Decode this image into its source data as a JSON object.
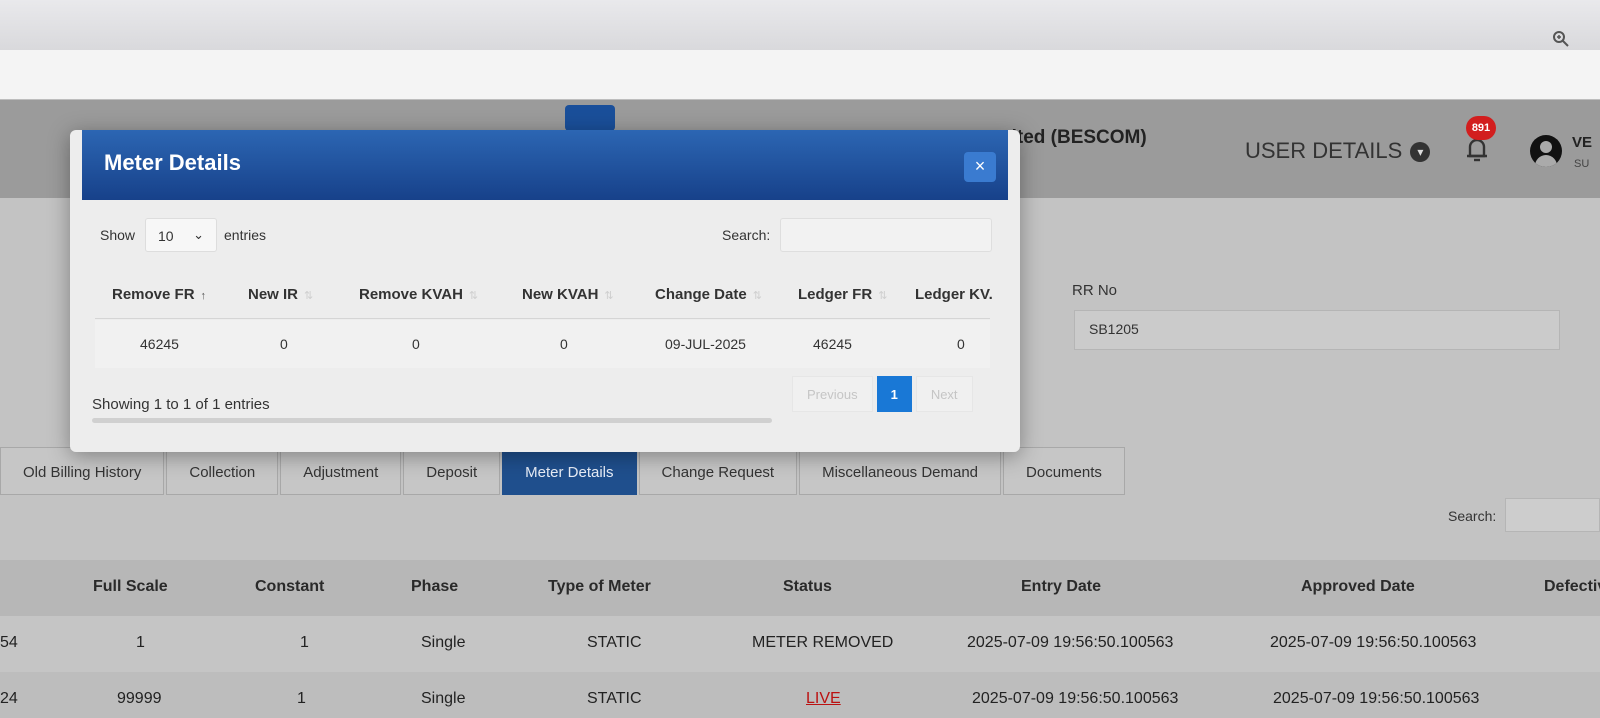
{
  "header": {
    "company": "nited (BESCOM)",
    "user_details": "USER DETAILS",
    "notification_count": "891",
    "user_name": "VE",
    "user_sub": "SU"
  },
  "form": {
    "rr_label": "RR No",
    "rr_value": "SB1205"
  },
  "tabs": [
    {
      "label": "Old Billing History"
    },
    {
      "label": "Collection"
    },
    {
      "label": "Adjustment"
    },
    {
      "label": "Deposit"
    },
    {
      "label": "Meter Details",
      "active": true
    },
    {
      "label": "Change Request"
    },
    {
      "label": "Miscellaneous Demand"
    },
    {
      "label": "Documents"
    }
  ],
  "bg_table": {
    "search_label": "Search:",
    "columns": [
      "Full Scale",
      "Constant",
      "Phase",
      "Type of Meter",
      "Status",
      "Entry Date",
      "Approved Date",
      "Defectiv"
    ],
    "rows": [
      {
        "id": "54",
        "full_scale": "1",
        "constant": "1",
        "phase": "Single",
        "type": "STATIC",
        "status": "METER REMOVED",
        "entry_date": "2025-07-09 19:56:50.100563",
        "approved_date": "2025-07-09 19:56:50.100563"
      },
      {
        "id": "24",
        "full_scale": "99999",
        "constant": "1",
        "phase": "Single",
        "type": "STATIC",
        "status": "LIVE",
        "entry_date": "2025-07-09 19:56:50.100563",
        "approved_date": "2025-07-09 19:56:50.100563"
      }
    ]
  },
  "modal": {
    "title": "Meter Details",
    "close_icon": "×",
    "show_label": "Show",
    "entries_value": "10",
    "entries_label": "entries",
    "search_label": "Search:",
    "columns": [
      "Remove FR",
      "New IR",
      "Remove KVAH",
      "New KVAH",
      "Change Date",
      "Ledger FR",
      "Ledger KV."
    ],
    "row": {
      "remove_fr": "46245",
      "new_ir": "0",
      "remove_kvah": "0",
      "new_kvah": "0",
      "change_date": "09-JUL-2025",
      "ledger_fr": "46245",
      "ledger_kv": "0"
    },
    "showing": "Showing 1 to 1 of 1 entries",
    "pager": {
      "previous": "Previous",
      "page": "1",
      "next": "Next"
    }
  },
  "colors": {
    "modal_header": "#17418a",
    "active_tab": "#1f4f8d",
    "page_button": "#1978d6",
    "badge": "#d21e1e",
    "live_status": "#bb1111"
  }
}
